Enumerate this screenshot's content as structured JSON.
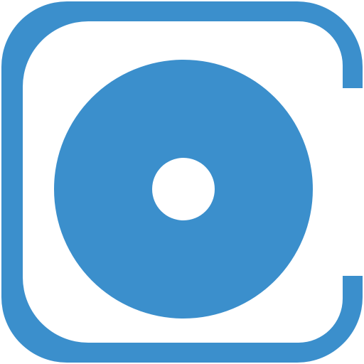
{
  "icon": {
    "name": "disc-app-icon",
    "brand_color": "#3b8fcc",
    "inner_color": "#ffffff",
    "glyph": "disc-icon"
  }
}
